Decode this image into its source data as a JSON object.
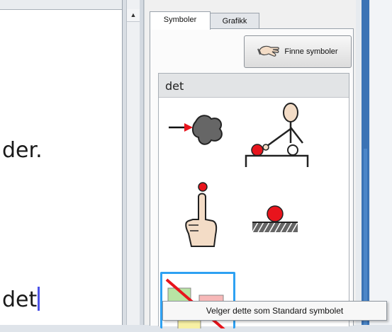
{
  "document": {
    "line1": "der.",
    "line2": "det"
  },
  "panel": {
    "tabs": [
      {
        "label": "Symboler",
        "active": true
      },
      {
        "label": "Grafikk",
        "active": false
      }
    ],
    "find_button_label": "Finne symboler",
    "current_word": "det",
    "symbols": [
      {
        "icon": "arrow-to-blob-symbol"
      },
      {
        "icon": "person-pointing-at-ball-symbol"
      },
      {
        "icon": "finger-pointing-symbol"
      },
      {
        "icon": "ball-on-ground-symbol"
      },
      {
        "icon": "no-symbol-selected",
        "selected": true
      }
    ]
  },
  "tooltip": {
    "text": "Velger dette som Standard symbolet"
  },
  "colors": {
    "caret": "#4b52e8",
    "selection": "#2ea1f2",
    "ball": "#e8141c",
    "window_edge": "#3b73b5"
  }
}
